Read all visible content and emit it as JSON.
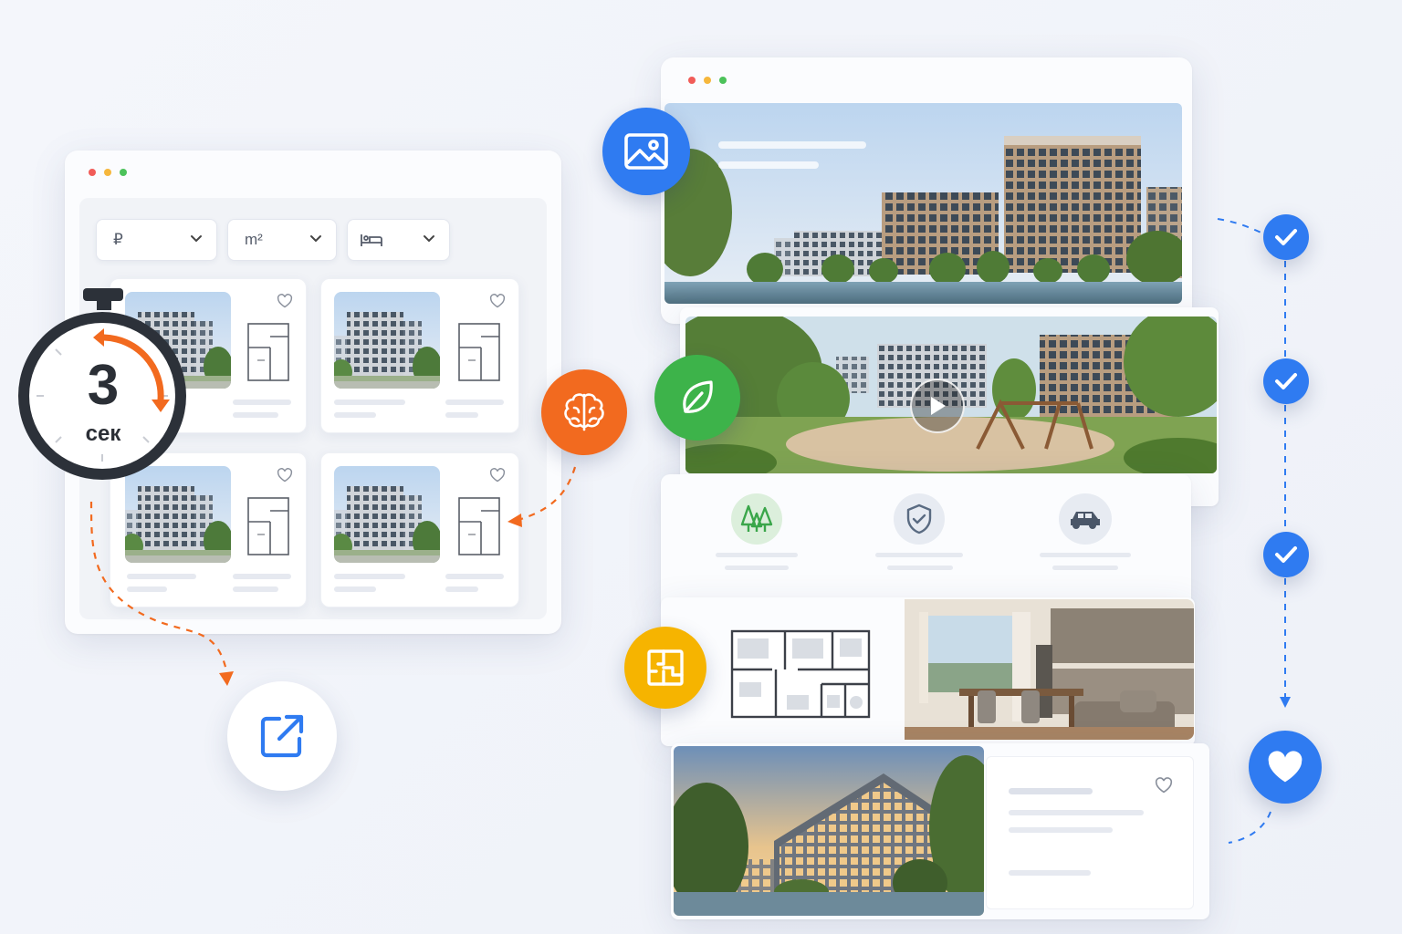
{
  "timer": {
    "value": "3",
    "unit": "сек"
  },
  "filters": [
    {
      "label": "₽",
      "icon": "ruble-icon"
    },
    {
      "label": "m²",
      "icon": "area-icon"
    },
    {
      "label": "",
      "icon": "bed-icon"
    }
  ],
  "listing_cards": [
    {
      "icon": "heart-icon"
    },
    {
      "icon": "heart-icon"
    },
    {
      "icon": "heart-icon"
    },
    {
      "icon": "heart-icon"
    }
  ],
  "feature_icons": [
    "image-icon",
    "leaf-icon",
    "floorplan-icon",
    "brain-icon",
    "external-link-icon"
  ],
  "amenities": [
    {
      "icon": "trees-icon"
    },
    {
      "icon": "shield-check-icon"
    },
    {
      "icon": "car-icon"
    }
  ],
  "progress_steps": [
    {
      "icon": "check-icon",
      "state": "done"
    },
    {
      "icon": "check-icon",
      "state": "done"
    },
    {
      "icon": "check-icon",
      "state": "done"
    },
    {
      "icon": "heart-icon",
      "state": "favorite"
    }
  ],
  "colors": {
    "accent_blue": "#2f7bf1",
    "accent_orange": "#f26a1f",
    "accent_green": "#3db34a",
    "accent_yellow": "#f6b400",
    "window_dot_red": "#f15c58",
    "window_dot_yellow": "#f6b73c",
    "window_dot_green": "#4cc25a"
  }
}
